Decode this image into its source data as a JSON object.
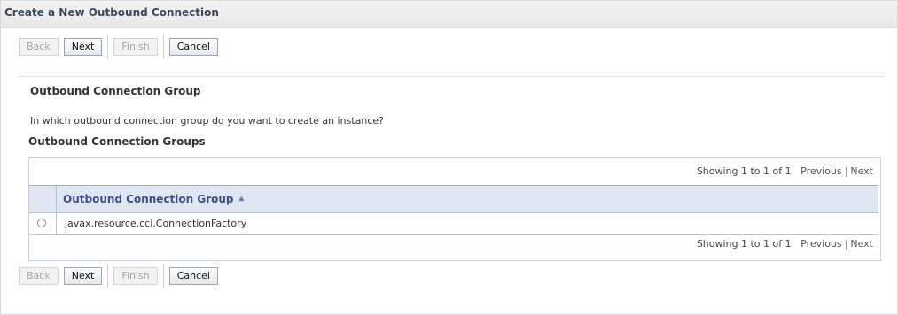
{
  "title": "Create a New Outbound Connection",
  "buttons": {
    "back": "Back",
    "next": "Next",
    "finish": "Finish",
    "cancel": "Cancel"
  },
  "section": {
    "title": "Outbound Connection Group",
    "description": "In which outbound connection group do you want to create an instance?",
    "table_title": "Outbound Connection Groups"
  },
  "pager": {
    "showing": "Showing 1 to 1 of 1",
    "previous": "Previous",
    "next": "Next"
  },
  "table": {
    "header": "Outbound Connection Group",
    "rows": [
      {
        "value": "javax.resource.cci.ConnectionFactory"
      }
    ]
  }
}
